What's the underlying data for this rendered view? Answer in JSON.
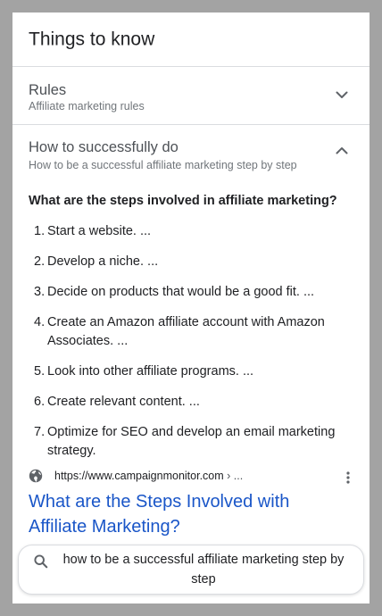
{
  "section": {
    "title": "Things to know"
  },
  "accordion": [
    {
      "title": "Rules",
      "subtitle": "Affiliate marketing rules",
      "expanded": false,
      "icon": "chevron-down-icon"
    },
    {
      "title": "How to successfully do",
      "subtitle": "How to be a successful affiliate marketing step by step",
      "expanded": true,
      "icon": "chevron-up-icon"
    }
  ],
  "answer": {
    "question": "What are the steps involved in affiliate marketing?",
    "steps": [
      {
        "num": "1.",
        "text": "Start a website. ..."
      },
      {
        "num": "2.",
        "text": "Develop a niche. ..."
      },
      {
        "num": "3.",
        "text": "Decide on products that would be a good fit. ..."
      },
      {
        "num": "4.",
        "text": "Create an Amazon affiliate account with Amazon Associates. ..."
      },
      {
        "num": "5.",
        "text": "Look into other affiliate programs. ..."
      },
      {
        "num": "6.",
        "text": "Create relevant content. ..."
      },
      {
        "num": "7.",
        "text": "Optimize for SEO and develop an email marketing strategy."
      }
    ]
  },
  "source": {
    "url": "https://www.campaignmonitor.com",
    "breadcrumb": " › ...",
    "title": "What are the Steps Involved with Affiliate Marketing?",
    "icon": "globe-icon",
    "menu_icon": "more-vert-icon"
  },
  "related_search": {
    "icon": "search-icon",
    "query": "how to be a successful affiliate marketing step by step"
  },
  "colors": {
    "link": "#1a56c8",
    "text": "#202124",
    "muted": "#70757a",
    "divider": "#dadce0",
    "backdrop": "#a3a3a3"
  }
}
